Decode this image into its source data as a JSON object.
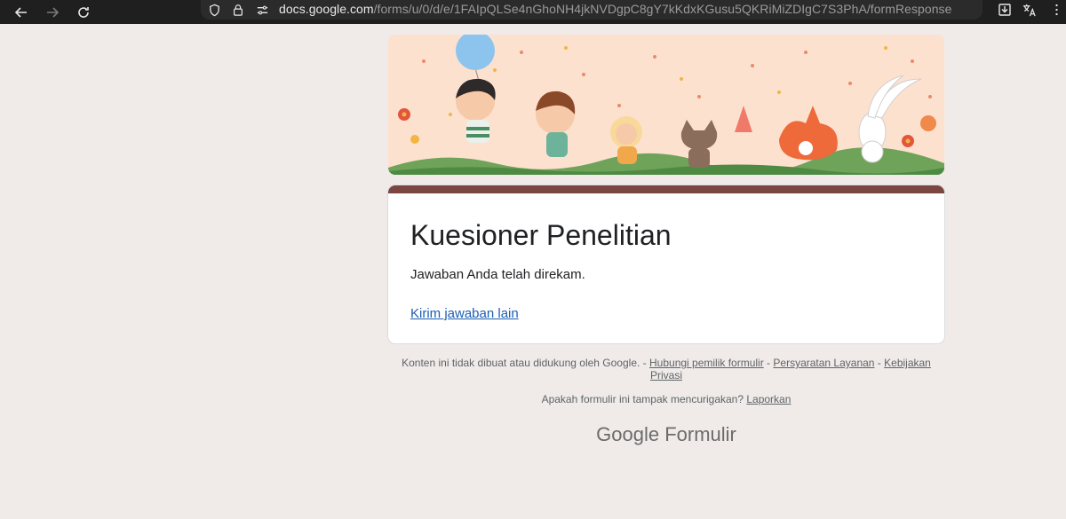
{
  "browser": {
    "url_host": "docs.google.com",
    "url_path": "/forms/u/0/d/e/1FAIpQLSe4nGhoNH4jkNVDgpC8gY7kKdxKGusu5QKRiMiZDIgC7S3PhA/formResponse"
  },
  "form": {
    "title": "Kuesioner Penelitian",
    "confirmation": "Jawaban Anda telah direkam.",
    "submit_another": "Kirim jawaban lain"
  },
  "footer": {
    "disclaimer": "Konten ini tidak dibuat atau didukung oleh Google. - ",
    "contact_owner": "Hubungi pemilik formulir",
    "sep1": " - ",
    "terms": "Persyaratan Layanan",
    "sep2": " - ",
    "privacy": "Kebijakan Privasi",
    "suspicious": "Apakah formulir ini tampak mencurigakan? ",
    "report": "Laporkan"
  },
  "brand": {
    "google": "Google",
    "product": "Formulir"
  },
  "colors": {
    "page_bg": "#f0ebe9",
    "theme": "#7b4541",
    "link": "#1a5fb4"
  }
}
